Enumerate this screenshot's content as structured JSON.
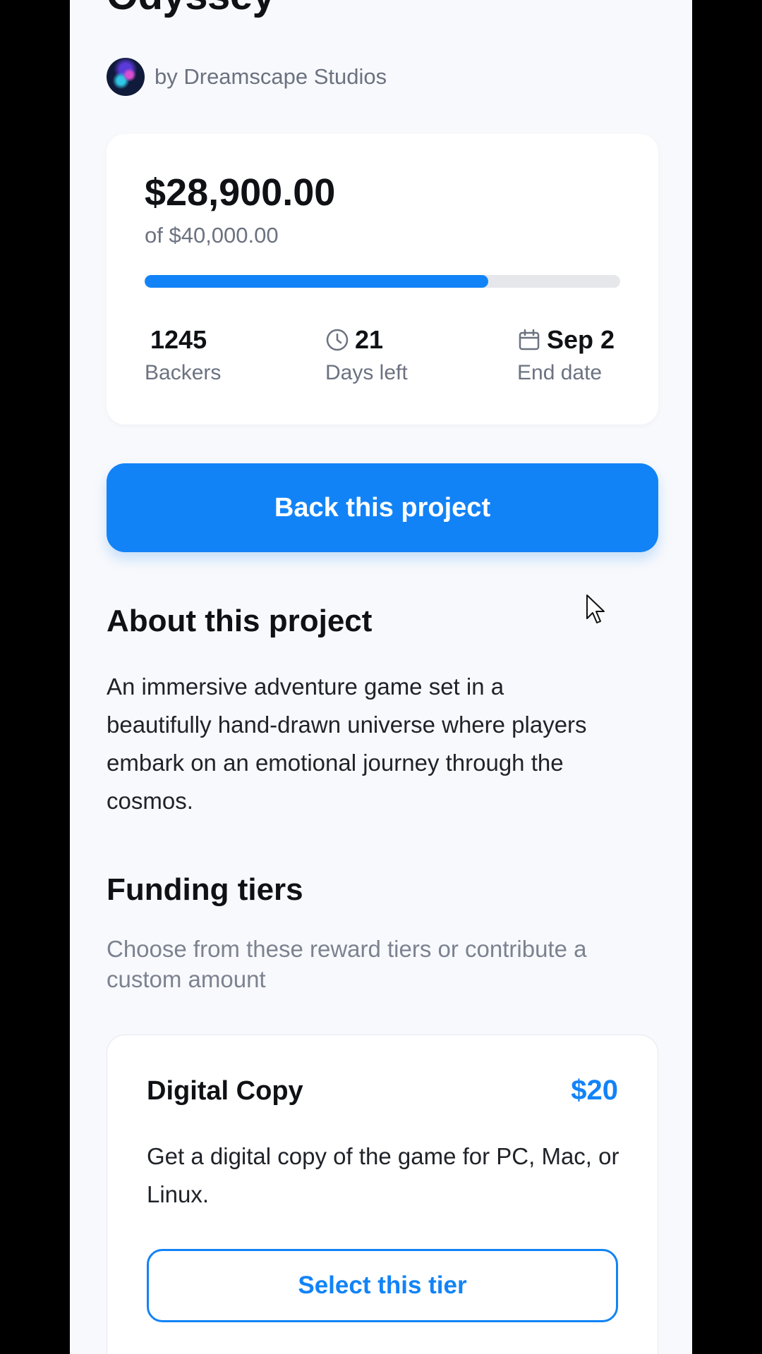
{
  "project": {
    "title_fragment": "Odyssey",
    "creator": "by Dreamscape Studios"
  },
  "funding": {
    "raised": "$28,900.00",
    "goal": "of $40,000.00",
    "progress_fraction": 0.7225,
    "backers_value": "1245",
    "backers_label": "Backers",
    "days_value": "21",
    "days_label": "Days left",
    "end_value": "Sep 2",
    "end_label": "End date"
  },
  "cta": {
    "label": "Back this project"
  },
  "about": {
    "heading": "About this project",
    "text": "An immersive adventure game set in a beautifully hand-drawn universe where players embark on an emotional journey through the cosmos."
  },
  "tiers": {
    "heading": "Funding tiers",
    "subtitle": "Choose from these reward tiers or contribute a custom amount",
    "items": [
      {
        "name": "Digital Copy",
        "price": "$20",
        "description": "Get a digital copy of the game for PC, Mac, or Linux.",
        "button": "Select this tier"
      }
    ]
  },
  "colors": {
    "accent": "#1283f7",
    "background": "#f8f9fc",
    "card": "#ffffff",
    "muted_text": "#6b7280"
  },
  "icons": {
    "days": "clock-icon",
    "end": "calendar-icon",
    "cursor": "mouse-pointer-icon"
  }
}
